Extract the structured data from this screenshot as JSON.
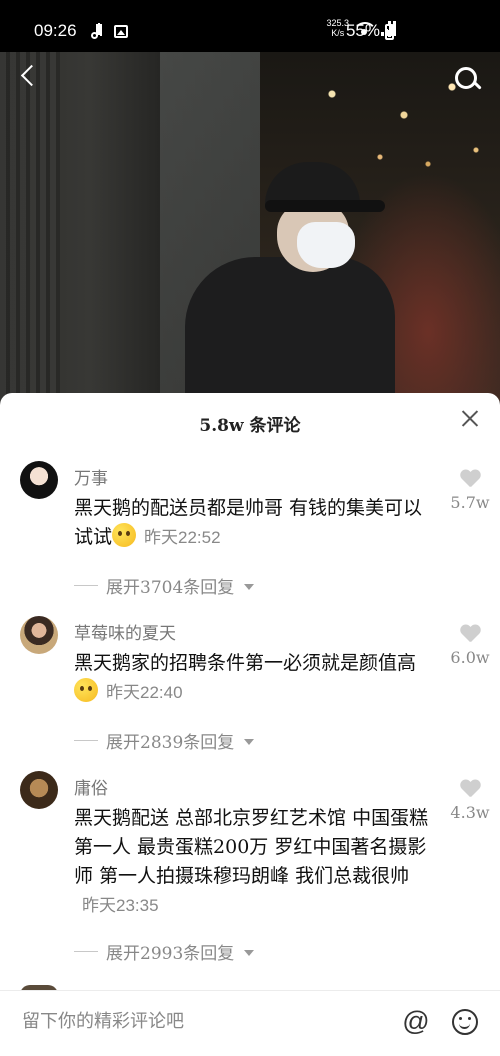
{
  "status_bar": {
    "time": "09:26",
    "net_speed_value": "325.3",
    "net_speed_unit": "K/s",
    "battery": "55%",
    "icons": [
      "tiktok-icon",
      "gallery-icon",
      "wifi-icon",
      "signal-icon",
      "battery-icon"
    ]
  },
  "video": {
    "back_icon": "back-icon",
    "search_icon": "search-icon"
  },
  "comments_panel": {
    "title": "5.8w 条评论",
    "close_icon": "close-icon",
    "comments": [
      {
        "username": "万事",
        "text": "黑天鹅的配送员都是帅哥 有钱的集美可以试试",
        "emoji": "emoji-icon",
        "time": "昨天22:52",
        "likes": "5.7w",
        "expand": "展开3704条回复"
      },
      {
        "username": "草莓味的夏天",
        "text": "黑天鹅家的招聘条件第一必须就是颜值高",
        "emoji": "emoji-icon",
        "time": "昨天22:40",
        "likes": "6.0w",
        "expand": "展开2839条回复"
      },
      {
        "username": "庸俗",
        "text": "黑天鹅配送 总部北京罗红艺术馆 中国蛋糕第一人 最贵蛋糕200万 罗红中国著名摄影师 第一人拍摄珠穆玛朗峰 我们总裁很帅",
        "emoji": "",
        "time": "昨天23:35",
        "likes": "4.3w",
        "expand": "展开2993条回复"
      }
    ]
  },
  "input_bar": {
    "placeholder": "留下你的精彩评论吧",
    "icons": [
      "at-icon",
      "emoji-icon"
    ]
  }
}
